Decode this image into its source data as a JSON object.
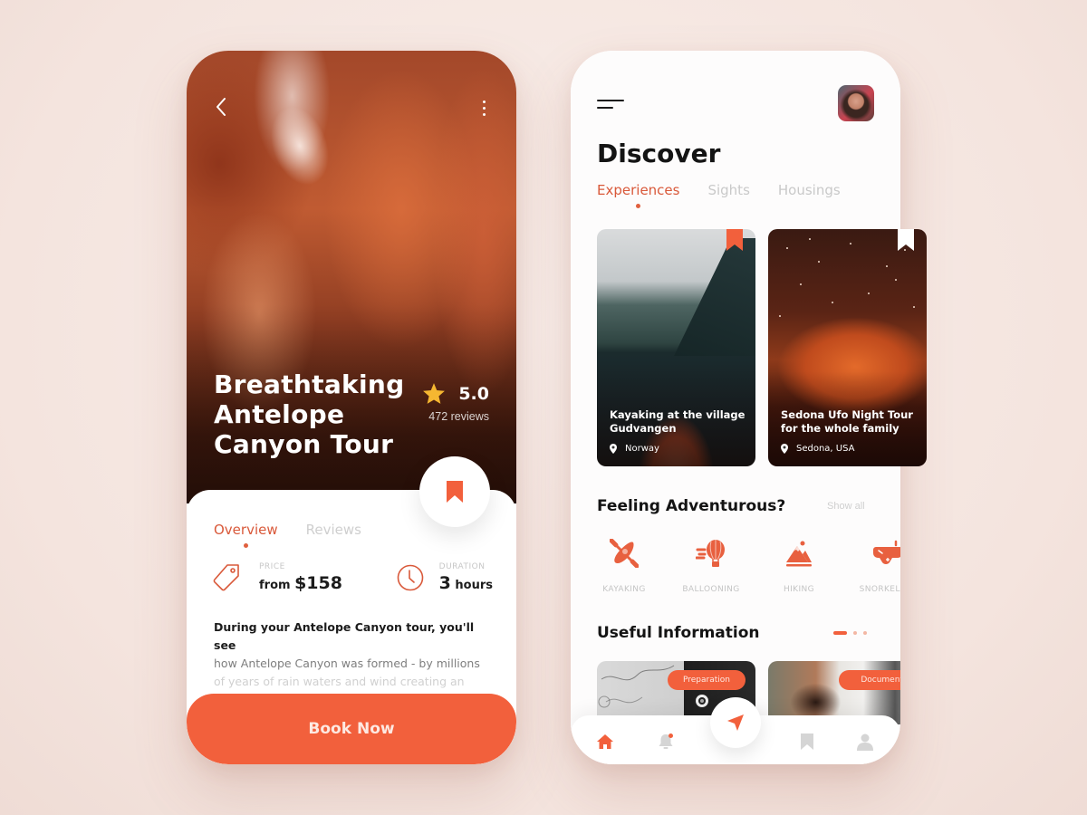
{
  "colors": {
    "accent": "#f2603c",
    "accent_text": "#d9593a",
    "star": "#f5b731",
    "background": "#f6e8e3"
  },
  "detail_screen": {
    "back_icon": "chevron-left-icon",
    "more_icon": "more-vertical-icon",
    "title_lines": [
      "Breathtaking",
      "Antelope",
      "Canyon Tour"
    ],
    "rating": {
      "icon": "star-icon",
      "value": "5.0",
      "reviews": "472 reviews"
    },
    "bookmark_icon": "bookmark-icon",
    "tabs": [
      {
        "label": "Overview",
        "active": true
      },
      {
        "label": "Reviews",
        "active": false
      }
    ],
    "price": {
      "icon": "price-tag-icon",
      "label": "PRICE",
      "prefix": "from",
      "value": "$158"
    },
    "duration": {
      "icon": "clock-icon",
      "label": "DURATION",
      "value": "3",
      "unit": "hours"
    },
    "description_lines": [
      "During your Antelope Canyon tour, you'll see",
      "how Antelope Canyon was formed - by millions",
      "of years of rain waters and wind creating an"
    ],
    "book_button": "Book Now"
  },
  "discover_screen": {
    "menu_icon": "hamburger-menu-icon",
    "avatar": "user-avatar",
    "title": "Discover",
    "tabs": [
      {
        "label": "Experiences",
        "active": true
      },
      {
        "label": "Sights",
        "active": false
      },
      {
        "label": "Housings",
        "active": false
      }
    ],
    "experiences": [
      {
        "title": "Kayaking at the village Gudvangen",
        "location": "Norway",
        "bookmarked": true
      },
      {
        "title": "Sedona Ufo Night Tour for the whole family",
        "location": "Sedona, USA",
        "bookmarked": false
      }
    ],
    "adventure_section": {
      "title": "Feeling Adventurous?",
      "show_all": "Show all",
      "activities": [
        {
          "label": "KAYAKING",
          "icon": "kayak-icon"
        },
        {
          "label": "BALLOONING",
          "icon": "hot-air-balloon-icon"
        },
        {
          "label": "HIKING",
          "icon": "mountain-icon"
        },
        {
          "label": "SNORKELING",
          "icon": "snorkel-mask-icon"
        }
      ]
    },
    "info_section": {
      "title": "Useful Information",
      "pager": {
        "pages": 3,
        "current": 1
      },
      "cards": [
        {
          "label": "Preparation"
        },
        {
          "label": "Documents"
        }
      ]
    },
    "bottom_nav": [
      {
        "name": "home",
        "icon": "home-icon",
        "active": true
      },
      {
        "name": "notifications",
        "icon": "bell-icon",
        "badge": true
      },
      {
        "name": "navigate",
        "icon": "navigation-arrow-icon"
      },
      {
        "name": "saved",
        "icon": "bookmark-icon"
      },
      {
        "name": "profile",
        "icon": "user-icon"
      }
    ]
  }
}
